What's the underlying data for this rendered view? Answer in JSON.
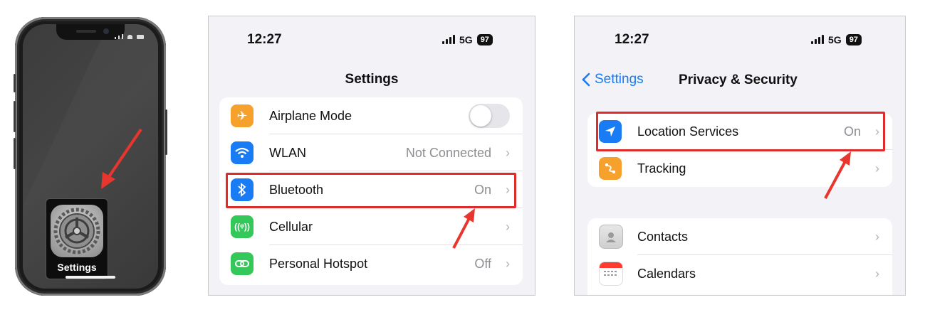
{
  "phone": {
    "app_label": "Settings"
  },
  "settings_panel": {
    "time": "12:27",
    "network": "5G",
    "battery": "97",
    "title": "Settings",
    "rows": [
      {
        "label": "Airplane Mode",
        "value": "",
        "icon": "airplane-icon",
        "color": "#f6a12b"
      },
      {
        "label": "WLAN",
        "value": "Not Connected",
        "icon": "wifi-icon",
        "color": "#1a7cf5"
      },
      {
        "label": "Bluetooth",
        "value": "On",
        "icon": "bluetooth-icon",
        "color": "#1a7cf5"
      },
      {
        "label": "Cellular",
        "value": "",
        "icon": "cellular-icon",
        "color": "#34c759"
      },
      {
        "label": "Personal Hotspot",
        "value": "Off",
        "icon": "hotspot-icon",
        "color": "#34c759"
      }
    ]
  },
  "privacy_panel": {
    "time": "12:27",
    "network": "5G",
    "battery": "97",
    "back_label": "Settings",
    "title": "Privacy & Security",
    "group1": [
      {
        "label": "Location Services",
        "value": "On",
        "icon": "location-arrow-icon",
        "color": "#1a7cf5"
      },
      {
        "label": "Tracking",
        "value": "",
        "icon": "tracking-icon",
        "color": "#f6a12b"
      }
    ],
    "group2": [
      {
        "label": "Contacts",
        "value": "",
        "icon": "contacts-icon",
        "color": "#d9d9d9"
      },
      {
        "label": "Calendars",
        "value": "",
        "icon": "calendar-icon",
        "color": "#ffffff"
      }
    ]
  },
  "colors": {
    "highlight": "#e02b2b",
    "ios_blue": "#1a7cf5"
  }
}
